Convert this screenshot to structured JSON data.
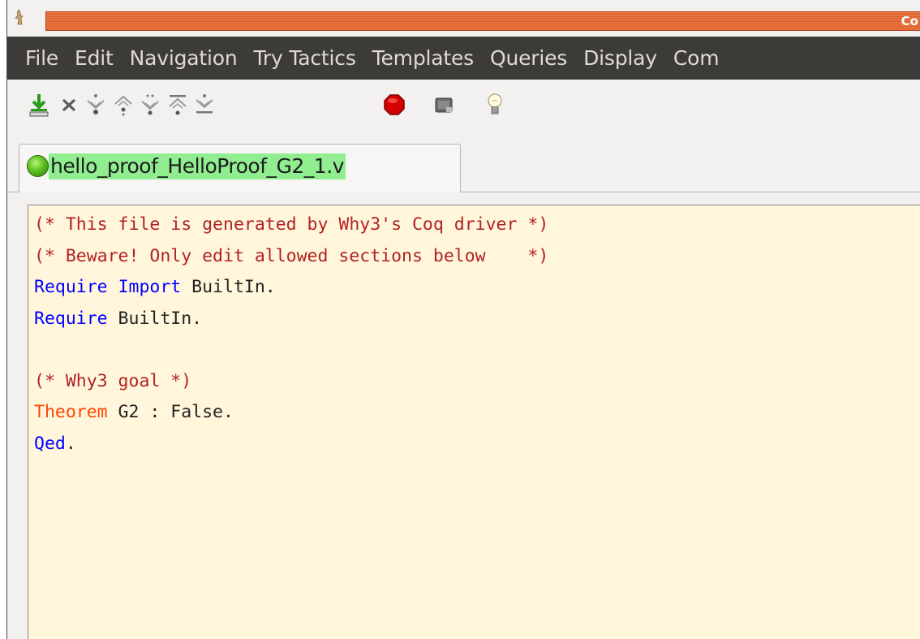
{
  "window": {
    "title_visible": "Co",
    "title_bar_color": "#e9743f"
  },
  "menu": {
    "items": [
      "File",
      "Edit",
      "Navigation",
      "Try Tactics",
      "Templates",
      "Queries",
      "Display",
      "Com"
    ]
  },
  "toolbar": {
    "buttons": [
      {
        "icon": "save-icon"
      },
      {
        "icon": "close-icon"
      },
      {
        "icon": "forward-one-step-icon"
      },
      {
        "icon": "backward-one-step-icon"
      },
      {
        "icon": "go-to-cursor-icon"
      },
      {
        "icon": "go-to-start-icon"
      },
      {
        "icon": "go-to-end-icon"
      },
      {
        "icon": "stop-icon"
      },
      {
        "icon": "query-pane-icon"
      },
      {
        "icon": "hint-lightbulb-icon"
      }
    ]
  },
  "tab": {
    "label": "hello_proof_HelloProof_G2_1.v",
    "status": "proved",
    "status_color": "#5bc21e",
    "highlight_color": "#90ee90"
  },
  "editor": {
    "background": "#fff6dc",
    "lines": [
      {
        "segments": [
          {
            "text": "(* This file is generated by Why3's Coq driver *)",
            "style": "comment"
          }
        ]
      },
      {
        "segments": [
          {
            "text": "(* Beware! Only edit allowed sections below    *)",
            "style": "comment"
          }
        ]
      },
      {
        "segments": [
          {
            "text": "Require",
            "style": "keyword"
          },
          {
            "text": " ",
            "style": "plain"
          },
          {
            "text": "Import",
            "style": "keyword"
          },
          {
            "text": " BuiltIn.",
            "style": "plain"
          }
        ]
      },
      {
        "segments": [
          {
            "text": "Require",
            "style": "keyword"
          },
          {
            "text": " BuiltIn.",
            "style": "plain"
          }
        ]
      },
      {
        "segments": []
      },
      {
        "segments": [
          {
            "text": "(* Why3 goal *)",
            "style": "comment"
          }
        ]
      },
      {
        "segments": [
          {
            "text": "Theorem",
            "style": "theorem"
          },
          {
            "text": " G2 : False.",
            "style": "plain"
          }
        ]
      },
      {
        "segments": [
          {
            "text": "Qed",
            "style": "keyword"
          },
          {
            "text": ".",
            "style": "plain"
          }
        ]
      }
    ]
  }
}
